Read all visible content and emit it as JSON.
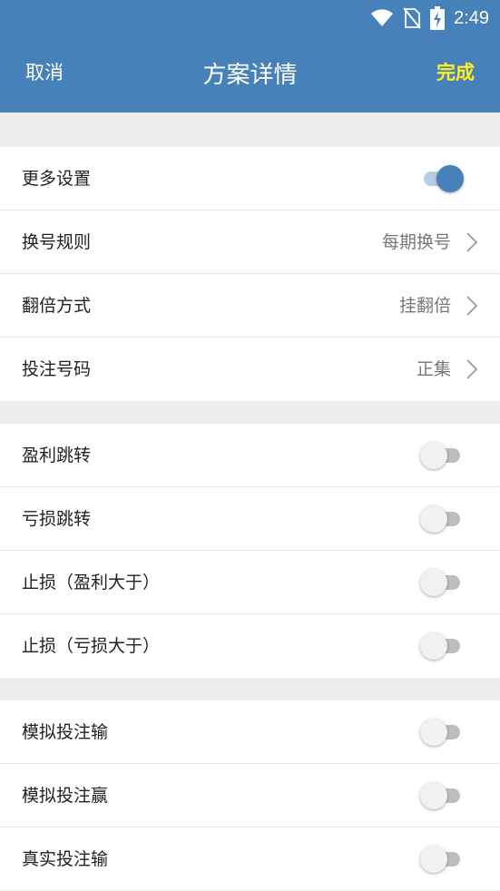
{
  "status_bar": {
    "time": "2:49",
    "icons": [
      "wifi-icon",
      "no-sim-icon",
      "battery-charging-icon"
    ]
  },
  "nav": {
    "cancel_label": "取消",
    "title": "方案详情",
    "done_label": "完成"
  },
  "groups": [
    {
      "rows": [
        {
          "label": "更多设置",
          "type": "toggle",
          "on": true
        },
        {
          "label": "换号规则",
          "type": "select",
          "value": "每期换号"
        },
        {
          "label": "翻倍方式",
          "type": "select",
          "value": "挂翻倍"
        },
        {
          "label": "投注号码",
          "type": "select",
          "value": "正集"
        }
      ]
    },
    {
      "rows": [
        {
          "label": "盈利跳转",
          "type": "toggle",
          "on": false
        },
        {
          "label": "亏损跳转",
          "type": "toggle",
          "on": false
        },
        {
          "label": "止损（盈利大于）",
          "type": "toggle",
          "on": false
        },
        {
          "label": "止损（亏损大于）",
          "type": "toggle",
          "on": false
        }
      ]
    },
    {
      "rows": [
        {
          "label": "模拟投注输",
          "type": "toggle",
          "on": false
        },
        {
          "label": "模拟投注赢",
          "type": "toggle",
          "on": false
        },
        {
          "label": "真实投注输",
          "type": "toggle",
          "on": false
        }
      ]
    }
  ],
  "colors": {
    "header": "#4781b9",
    "done": "#ffee22",
    "toggle_on": "#4781b9"
  }
}
